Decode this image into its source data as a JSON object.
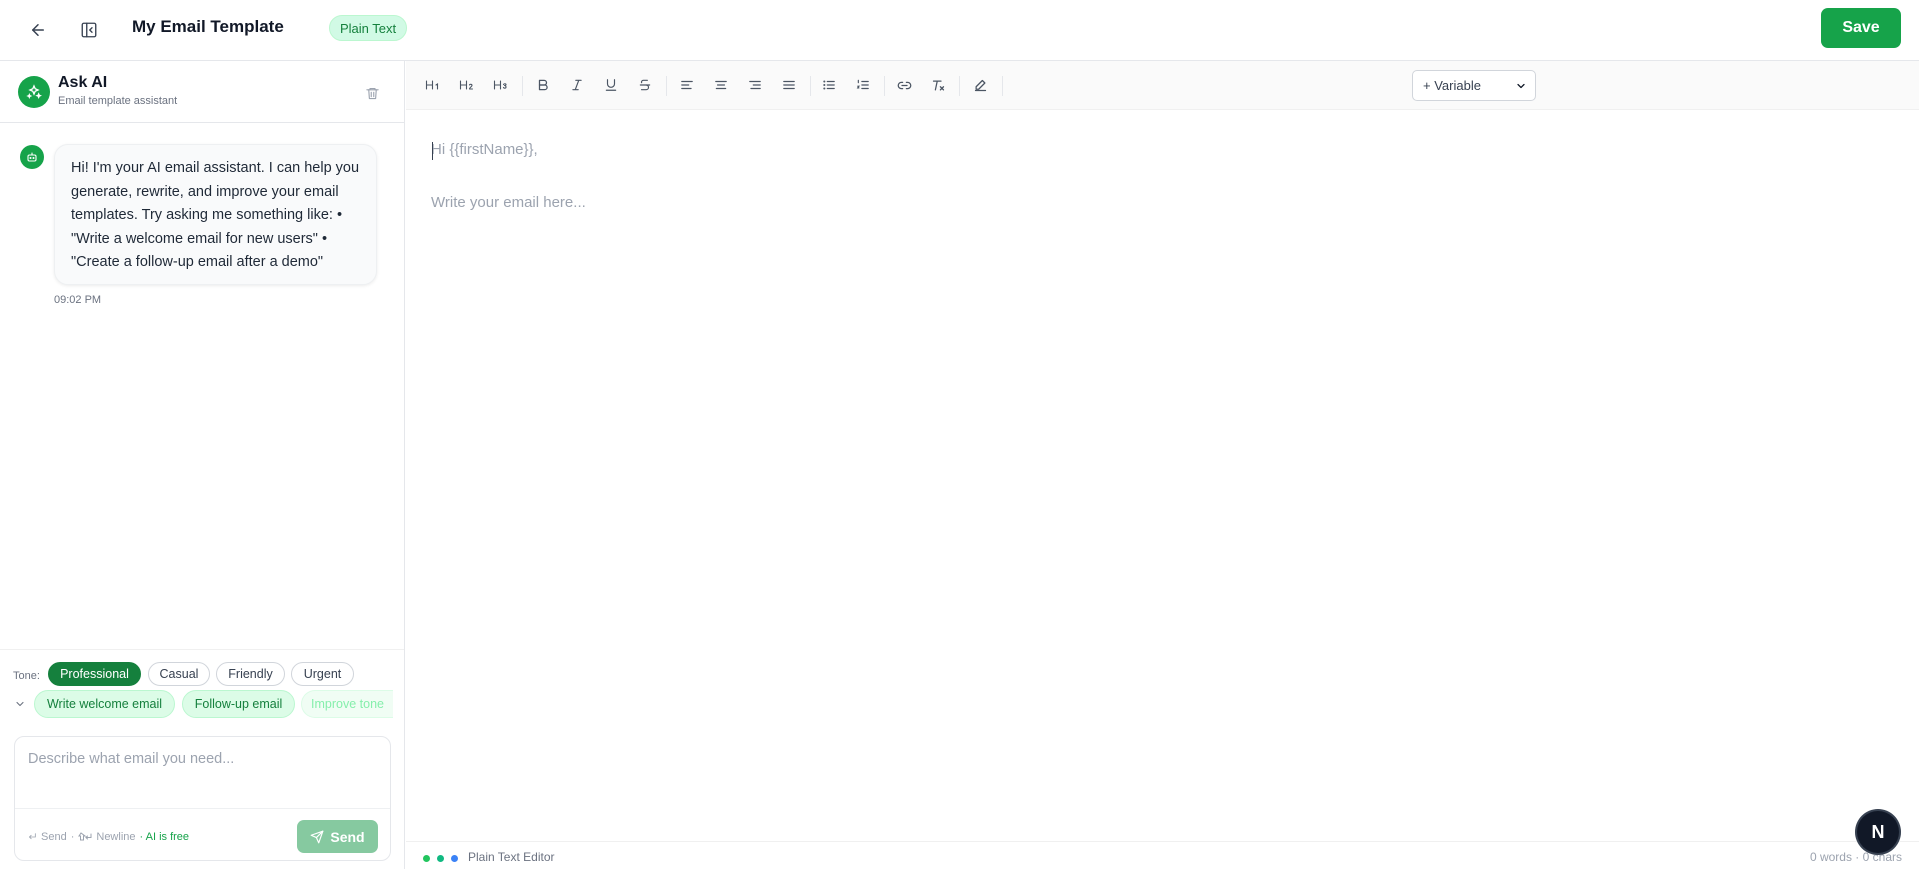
{
  "header": {
    "title": "My Email Template",
    "mode_badge": "Plain Text",
    "save_label": "Save"
  },
  "assistant": {
    "title": "Ask AI",
    "subtitle": "Email template assistant",
    "message": "Hi! I'm your AI email assistant. I can help you generate, rewrite, and improve your email templates. Try asking me something like: • \"Write a welcome email for new users\" • \"Create a follow-up email after a demo\"",
    "message_time": "09:02 PM"
  },
  "tone": {
    "label": "Tone:",
    "options": [
      "Professional",
      "Casual",
      "Friendly",
      "Urgent"
    ],
    "selected": "Professional"
  },
  "suggestions": [
    "Write welcome email",
    "Follow-up email",
    "Improve tone"
  ],
  "composer": {
    "placeholder": "Describe what email you need...",
    "hint_send": "Send",
    "hint_newline": "Newline",
    "hint_free": "· AI is free",
    "send_label": "Send"
  },
  "toolbar": {
    "variable_label": "+ Variable"
  },
  "editor": {
    "greeting": "Hi {{firstName}},",
    "body_placeholder": "Write your email here..."
  },
  "status": {
    "editor_label": "Plain Text Editor",
    "counts": "0 words · 0 chars",
    "dot_colors": [
      "#22c55e",
      "#10b981",
      "#3b82f6"
    ]
  },
  "colors": {
    "accent": "#16a34a",
    "accent_dark": "#15803d"
  },
  "floating_badge": "N"
}
